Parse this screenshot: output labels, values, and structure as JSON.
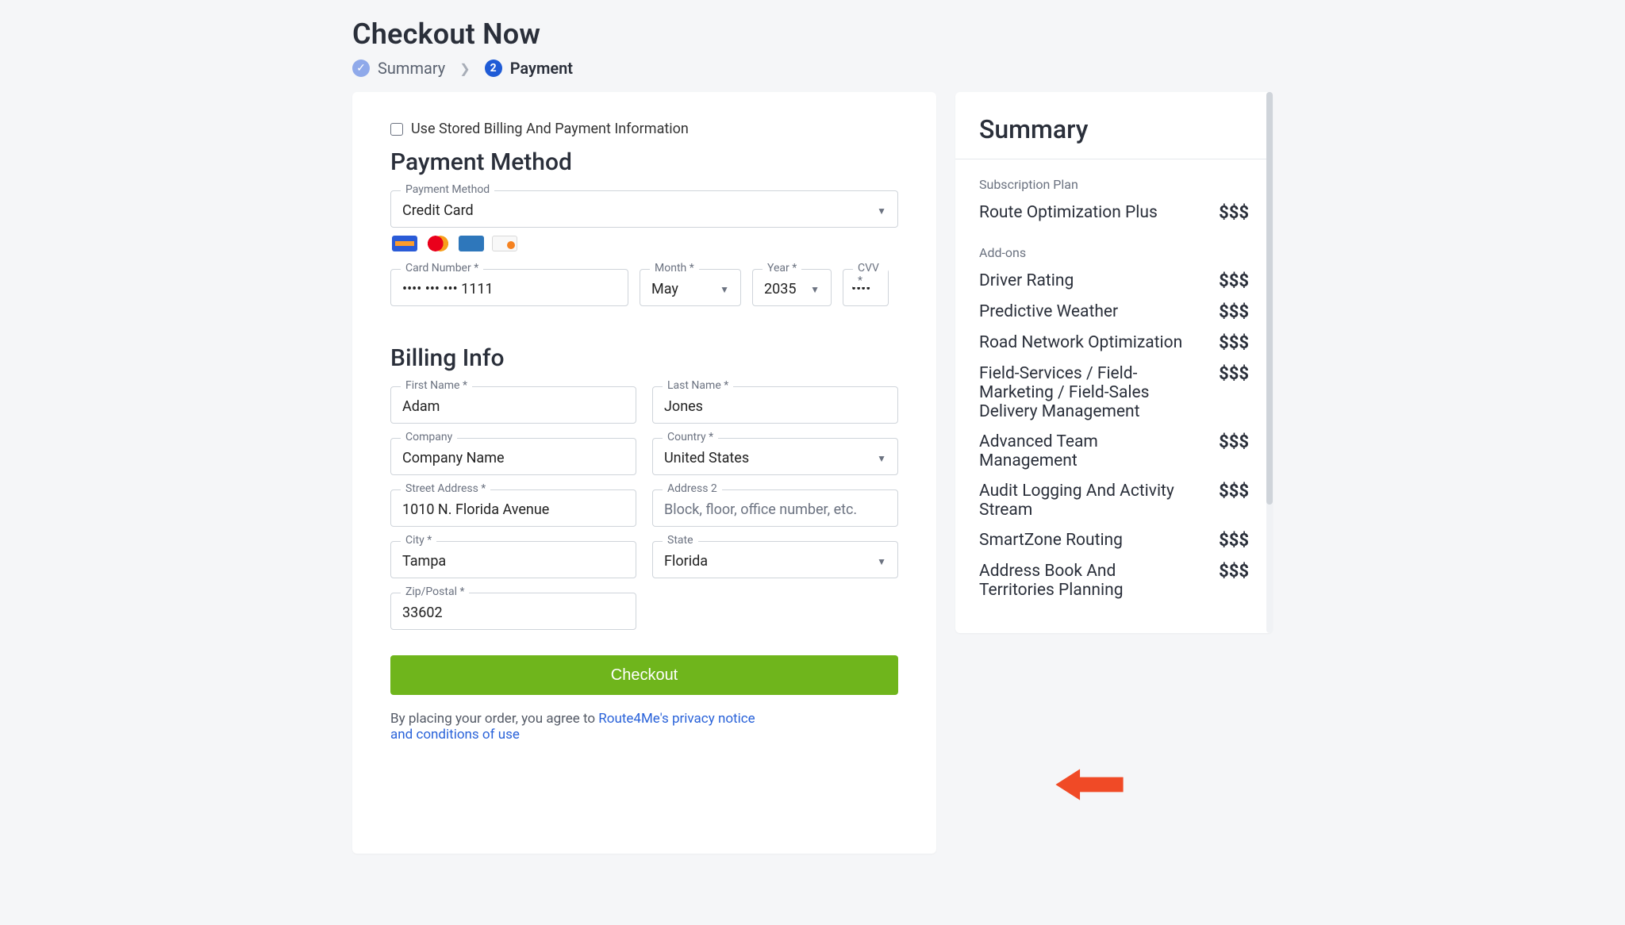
{
  "page": {
    "title": "Checkout Now"
  },
  "breadcrumbs": {
    "summary": "Summary",
    "stepnum": "2",
    "payment": "Payment"
  },
  "payment": {
    "use_stored_label": "Use Stored Billing And Payment Information",
    "section_title": "Payment Method",
    "method_label": "Payment Method",
    "method_value": "Credit Card",
    "card_number_label": "Card Number *",
    "card_number_value": "•••• ••• ••• 1111",
    "month_label": "Month *",
    "month_value": "May",
    "year_label": "Year *",
    "year_value": "2035",
    "cvv_label": "CVV *",
    "cvv_value": "••••"
  },
  "billing": {
    "section_title": "Billing Info",
    "first_name_label": "First Name *",
    "first_name_value": "Adam",
    "last_name_label": "Last Name *",
    "last_name_value": "Jones",
    "company_label": "Company",
    "company_value": "Company Name",
    "country_label": "Country *",
    "country_value": "United States",
    "street_label": "Street Address *",
    "street_value": "1010 N. Florida Avenue",
    "address2_label": "Address 2",
    "address2_placeholder": "Block, floor, office number, etc.",
    "city_label": "City *",
    "city_value": "Tampa",
    "state_label": "State",
    "state_value": "Florida",
    "zip_label": "Zip/Postal *",
    "zip_value": "33602"
  },
  "checkout": {
    "button": "Checkout"
  },
  "terms": {
    "prefix": "By placing your order, you agree to ",
    "link1": "Route4Me's privacy notice",
    "link2": "and conditions of use"
  },
  "summary": {
    "title": "Summary",
    "plan_label": "Subscription Plan",
    "plan_name": "Route Optimization Plus",
    "plan_price": "$$$",
    "addons_label": "Add-ons",
    "addons": [
      {
        "name": "Driver Rating",
        "price": "$$$"
      },
      {
        "name": "Predictive Weather",
        "price": "$$$"
      },
      {
        "name": "Road Network Optimization",
        "price": "$$$"
      },
      {
        "name": "Field-Services / Field-Marketing / Field-Sales Delivery Management",
        "price": "$$$"
      },
      {
        "name": "Advanced Team Management",
        "price": "$$$"
      },
      {
        "name": "Audit Logging And Activity Stream",
        "price": "$$$"
      },
      {
        "name": "SmartZone Routing",
        "price": "$$$"
      },
      {
        "name": "Address Book And Territories Planning",
        "price": "$$$"
      }
    ]
  }
}
